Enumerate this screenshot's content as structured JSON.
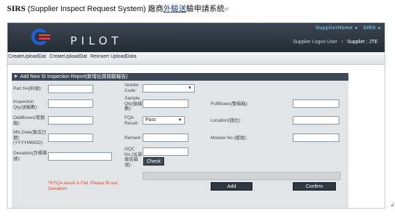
{
  "doc": {
    "title_bold": "SIRS",
    "title_mid": "(Supplier Inspect Request System) 廠商",
    "title_ul": "外驗送",
    "title_end": "驗申請系統",
    "para_mark": "↵",
    "corner_mark": "↲"
  },
  "header": {
    "brand": "PILOT",
    "nav_home": "SupplierHome ◂",
    "nav_sirs": "SIRS ◂",
    "user_label": "Supplier Logon User",
    "user_sep": "ı",
    "supplier": "Supplier : JTE"
  },
  "tabs": [
    "CreateUploadDat",
    "CreateUploadDat",
    "ReInsert",
    "UploadData"
  ],
  "form": {
    "title": "Add New SI Inspection Report(新增出貨檢驗報告)",
    "part_no": "Part No(料號):",
    "vendor_code": "Vendor Code:",
    "inspection_qty": "Inspection Qty(送驗數):",
    "sample_qty": "Sample Qty(抽樣數):",
    "full_boxes": "FullBoxes(整箱箱):",
    "odd_boxes": "OddBoxes(零散箱):",
    "fqa_result": "FQA Result:",
    "fqa_value": "Pass",
    "location": "Location(儲位):",
    "mfc_date": "Mfc.Date(製造日期)(YYYYMMDD):",
    "remark": "Remark:",
    "module_no": "Module No.(模號):",
    "deviation": "Deviation(詐標單號):",
    "oqc_no": "OQC No.(出貨報告編號):",
    "check_btn": "Check",
    "warning": "*If FQA result is Fail, Please fill out Deivation",
    "add_btn": "Add",
    "confirm_btn": "Confirm"
  }
}
